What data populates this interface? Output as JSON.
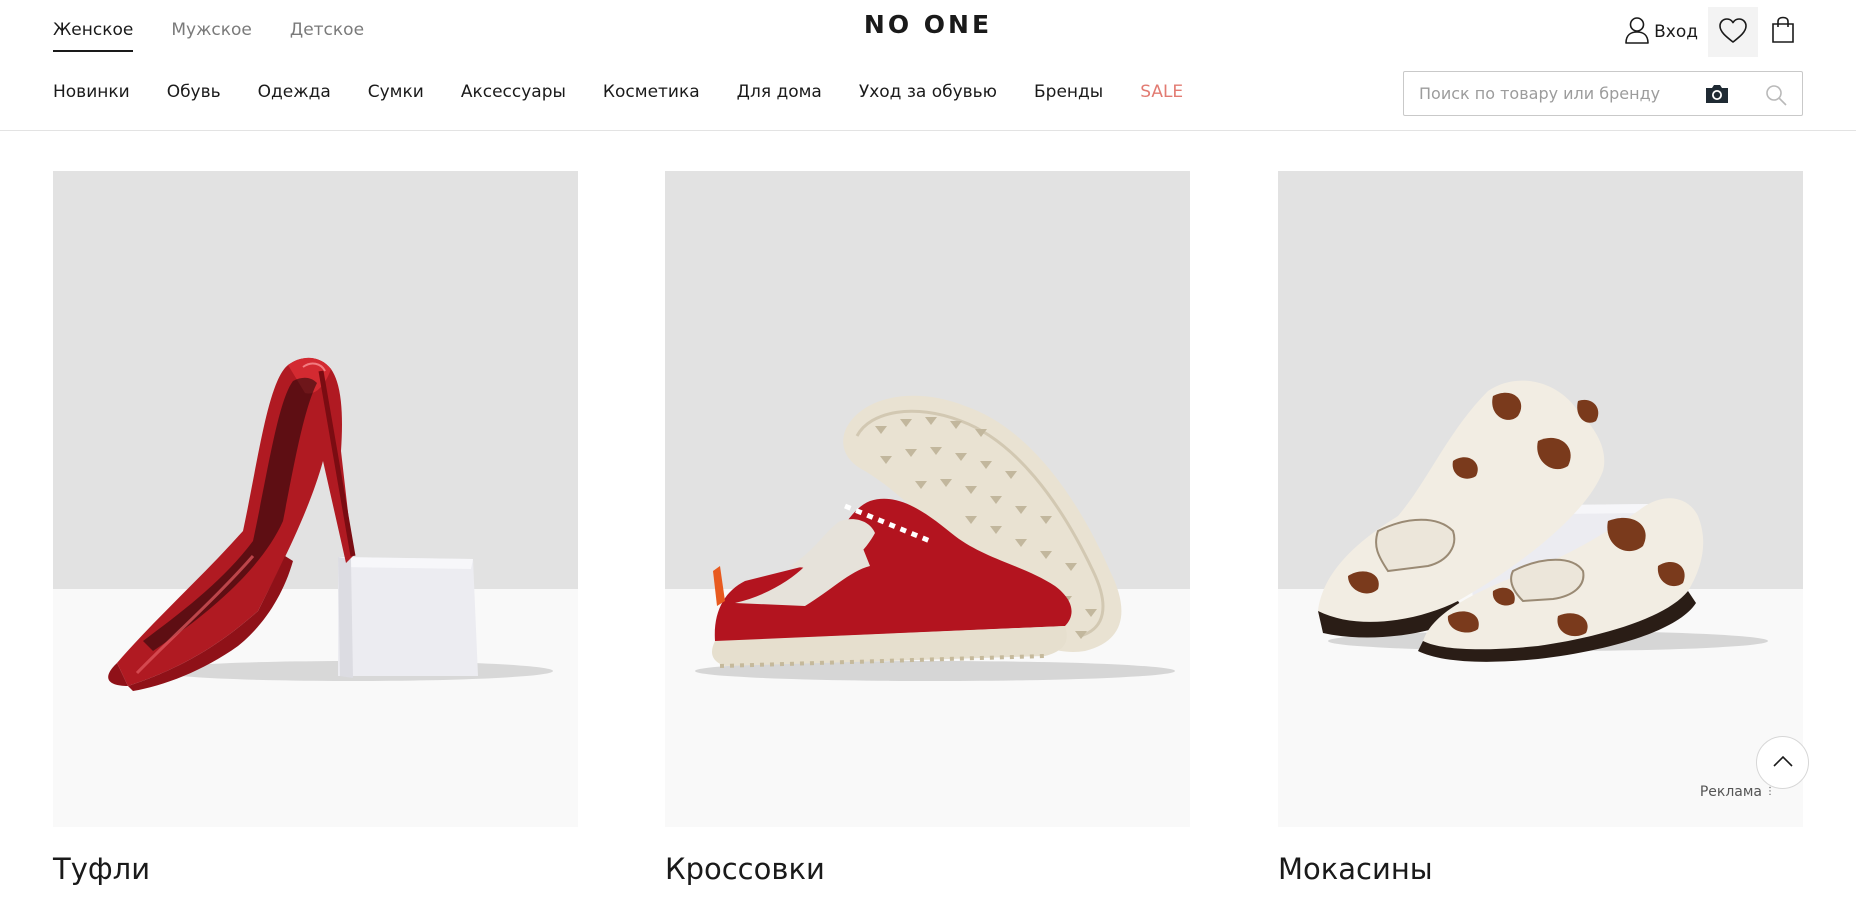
{
  "brand": {
    "logo": "NO ONE"
  },
  "gender_tabs": [
    {
      "label": "Женское",
      "active": true
    },
    {
      "label": "Мужское",
      "active": false
    },
    {
      "label": "Детское",
      "active": false
    }
  ],
  "header_actions": {
    "login_label": "Вход",
    "icons": [
      "user-icon",
      "heart-icon",
      "bag-icon"
    ]
  },
  "categories": [
    {
      "label": "Новинки"
    },
    {
      "label": "Обувь"
    },
    {
      "label": "Одежда"
    },
    {
      "label": "Сумки"
    },
    {
      "label": "Аксессуары"
    },
    {
      "label": "Косметика"
    },
    {
      "label": "Для дома"
    },
    {
      "label": "Уход за обувью"
    },
    {
      "label": "Бренды"
    },
    {
      "label": "SALE",
      "highlight": "#e27b72"
    }
  ],
  "search": {
    "placeholder": "Поиск по товару или бренду",
    "value": "",
    "icons": [
      "camera-icon",
      "search-icon"
    ]
  },
  "product_categories": [
    {
      "title": "Туфли",
      "image": "red patent stiletto pumps leaning on white box"
    },
    {
      "title": "Кроссовки",
      "image": "red suede sneakers with cream lug soles"
    },
    {
      "title": "Мокасины",
      "image": "cow-print pony hair penny loafers"
    }
  ],
  "ad": {
    "label": "Реклама"
  },
  "colors": {
    "text": "#1a1a1a",
    "muted": "#7a7a7a",
    "sale": "#e27b72",
    "wall": "#e2e2e2",
    "floor": "#f9f9f9"
  }
}
